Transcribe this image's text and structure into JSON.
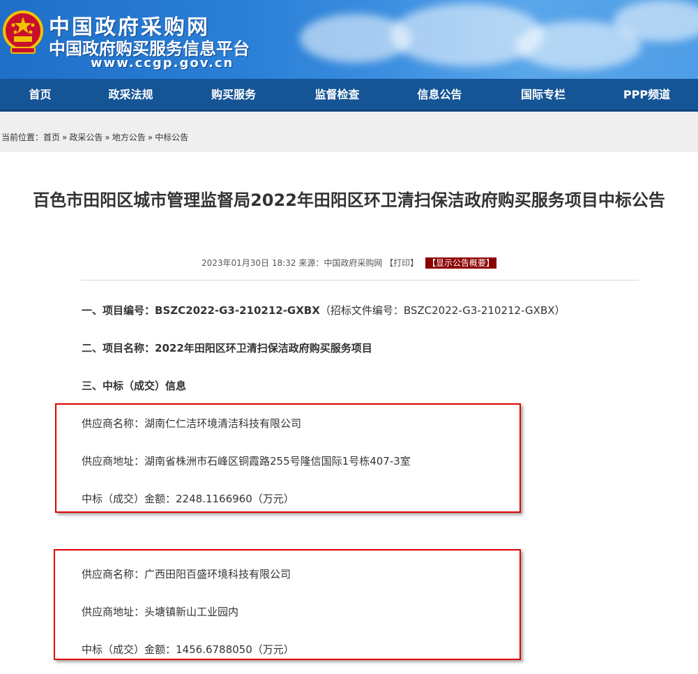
{
  "header": {
    "logo_cn_main": "中国政府采购网",
    "logo_cn_sub": "中国政府购买服务信息平台",
    "logo_url": "www.ccgp.gov.cn"
  },
  "nav": {
    "items": [
      {
        "label": "首页"
      },
      {
        "label": "政采法规"
      },
      {
        "label": "购买服务"
      },
      {
        "label": "监督检查"
      },
      {
        "label": "信息公告"
      },
      {
        "label": "国际专栏"
      },
      {
        "label": "PPP频道"
      }
    ]
  },
  "breadcrumb": {
    "prefix": "当前位置：",
    "items": [
      "首页",
      "政采公告",
      "地方公告",
      "中标公告"
    ],
    "separator": "»"
  },
  "article": {
    "title": "百色市田阳区城市管理监督局2022年田阳区环卫清扫保洁政府购买服务项目中标公告",
    "date": "2023年01月30日 18:32",
    "source_label": "来源：",
    "source": "中国政府采购网",
    "print_label": "【打印】",
    "summary_label": "【显示公告概要】",
    "section1_label": "一、项目编号：",
    "section1_value": "BSZC2022-G3-210212-GXBX",
    "section1_note": "（招标文件编号：BSZC2022-G3-210212-GXBX）",
    "section2_label": "二、项目名称：",
    "section2_value": "2022年田阳区环卫清扫保洁政府购买服务项目",
    "section3_label": "三、中标（成交）信息",
    "suppliers": [
      {
        "name_label": "供应商名称：",
        "name": "湖南仁仁洁环境清洁科技有限公司",
        "addr_label": "供应商地址：",
        "addr": "湖南省株洲市石峰区铜霞路255号隆信国际1号栋407-3室",
        "amount_label": "中标（成交）金额：",
        "amount": "2248.1166960（万元）"
      },
      {
        "name_label": "供应商名称：",
        "name": "广西田阳百盛环境科技有限公司",
        "addr_label": "供应商地址：",
        "addr": "头塘镇新山工业园内",
        "amount_label": "中标（成交）金额：",
        "amount": "1456.6788050（万元）"
      }
    ]
  },
  "colors": {
    "nav_bg": "#155596",
    "highlight_border": "#e00000",
    "summary_badge": "#8b0000"
  }
}
